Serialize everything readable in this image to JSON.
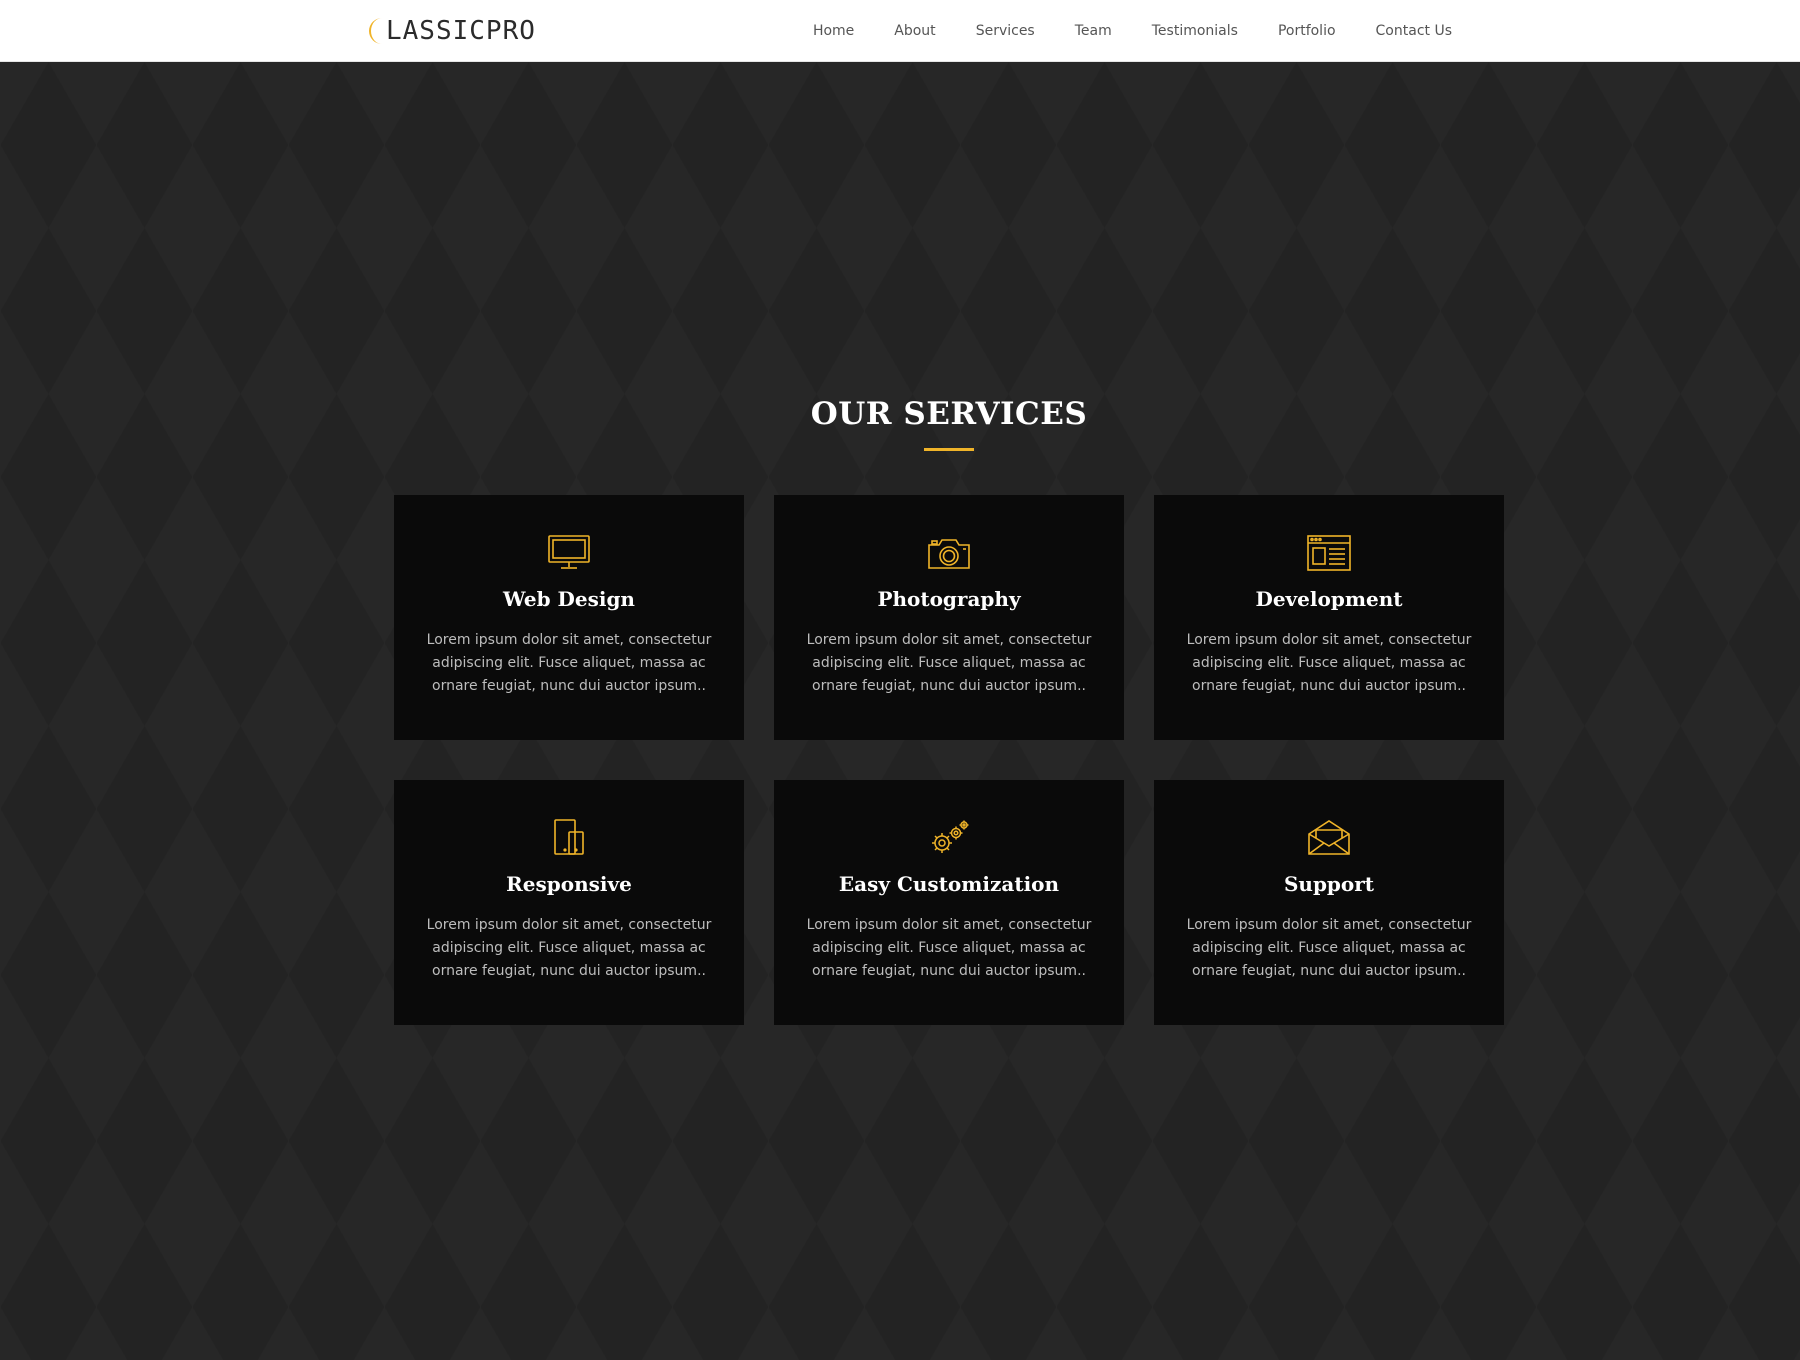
{
  "brand": {
    "logo_text": "LASSICPRO",
    "accent_color": "#f0b429"
  },
  "nav": {
    "items": [
      {
        "label": "Home"
      },
      {
        "label": "About"
      },
      {
        "label": "Services"
      },
      {
        "label": "Team"
      },
      {
        "label": "Testimonials"
      },
      {
        "label": "Portfolio"
      },
      {
        "label": "Contact Us"
      }
    ]
  },
  "services": {
    "title": "OUR SERVICES",
    "cards": [
      {
        "icon": "monitor-icon",
        "title": "Web Design",
        "text": "Lorem ipsum dolor sit amet, consectetur adipiscing elit. Fusce aliquet, massa ac ornare feugiat, nunc dui auctor ipsum.."
      },
      {
        "icon": "camera-icon",
        "title": "Photography",
        "text": "Lorem ipsum dolor sit amet, consectetur adipiscing elit. Fusce aliquet, massa ac ornare feugiat, nunc dui auctor ipsum.."
      },
      {
        "icon": "browser-window-icon",
        "title": "Development",
        "text": "Lorem ipsum dolor sit amet, consectetur adipiscing elit. Fusce aliquet, massa ac ornare feugiat, nunc dui auctor ipsum.."
      },
      {
        "icon": "devices-icon",
        "title": "Responsive",
        "text": "Lorem ipsum dolor sit amet, consectetur adipiscing elit. Fusce aliquet, massa ac ornare feugiat, nunc dui auctor ipsum.."
      },
      {
        "icon": "gears-icon",
        "title": "Easy Customization",
        "text": "Lorem ipsum dolor sit amet, consectetur adipiscing elit. Fusce aliquet, massa ac ornare feugiat, nunc dui auctor ipsum.."
      },
      {
        "icon": "envelope-icon",
        "title": "Support",
        "text": "Lorem ipsum dolor sit amet, consectetur adipiscing elit. Fusce aliquet, massa ac ornare feugiat, nunc dui auctor ipsum.."
      }
    ]
  }
}
